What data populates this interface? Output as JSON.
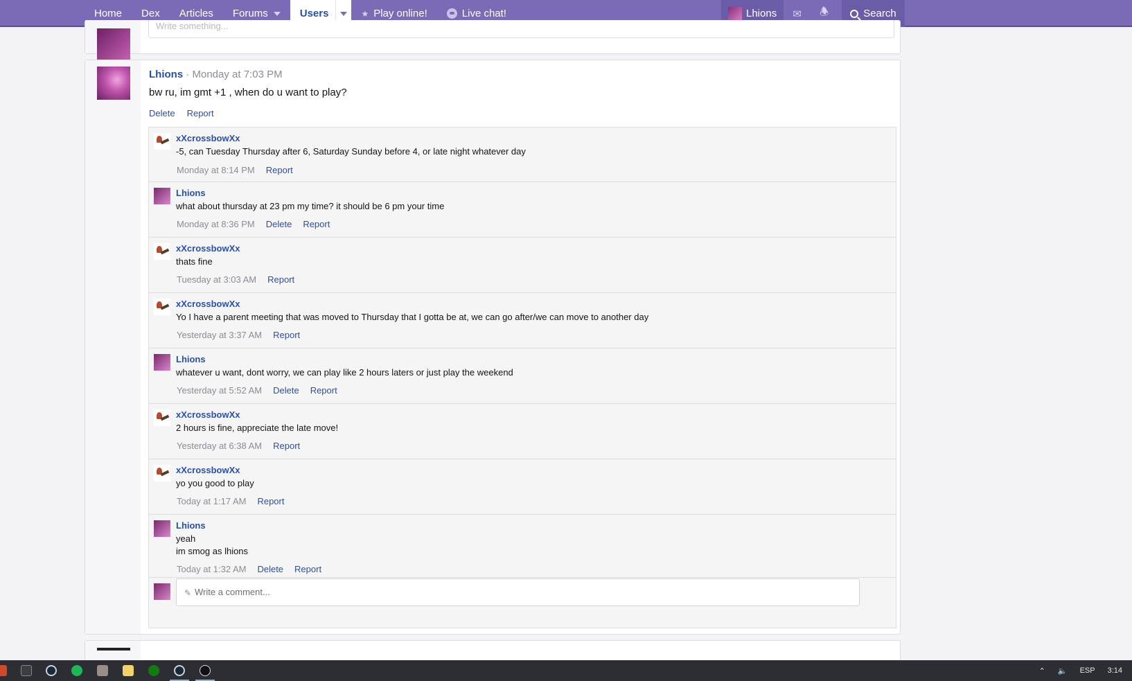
{
  "nav": {
    "items": [
      {
        "label": "Home"
      },
      {
        "label": "Dex"
      },
      {
        "label": "Articles"
      },
      {
        "label": "Forums"
      },
      {
        "label": "Users"
      },
      {
        "label": "Play online!"
      },
      {
        "label": "Live chat!"
      }
    ],
    "user": "Lhions",
    "search": "Search",
    "accent": "#7b6bb7"
  },
  "previous_comment_placeholder": "Write something...",
  "post": {
    "author": "Lhions",
    "time": "· Monday at 7:03 PM",
    "text": "bw ru, im gmt +1 , when do u want to play?",
    "actions": [
      "Delete",
      "Report"
    ]
  },
  "comments": [
    {
      "author": "xXcrossbowXx",
      "lines": [
        "-5, can Tuesday Thursday after 6, Saturday Sunday before 4, or late night whatever day"
      ],
      "time": "Monday at 8:14 PM",
      "actions": [
        "Report"
      ]
    },
    {
      "author": "Lhions",
      "lines": [
        "what about thursday at 23 pm my time? it should be 6 pm your time"
      ],
      "time": "Monday at 8:36 PM",
      "actions": [
        "Delete",
        "Report"
      ]
    },
    {
      "author": "xXcrossbowXx",
      "lines": [
        "thats fine"
      ],
      "time": "Tuesday at 3:03 AM",
      "actions": [
        "Report"
      ]
    },
    {
      "author": "xXcrossbowXx",
      "lines": [
        "Yo I have a parent meeting that was moved to Thursday that I gotta be at, we can go after/we can move to another day"
      ],
      "time": "Yesterday at 3:37 AM",
      "actions": [
        "Report"
      ]
    },
    {
      "author": "Lhions",
      "lines": [
        "whatever u want, dont worry, we can play like 2 hours laters or just play the weekend"
      ],
      "time": "Yesterday at 5:52 AM",
      "actions": [
        "Delete",
        "Report"
      ]
    },
    {
      "author": "xXcrossbowXx",
      "lines": [
        "2 hours is fine, appreciate the late move!"
      ],
      "time": "Yesterday at 6:38 AM",
      "actions": [
        "Report"
      ]
    },
    {
      "author": "xXcrossbowXx",
      "lines": [
        "yo you good to play"
      ],
      "time": "Today at 1:17 AM",
      "actions": [
        "Report"
      ]
    },
    {
      "author": "Lhions",
      "lines": [
        "yeah",
        "im smog as lhions"
      ],
      "time": "Today at 1:32 AM",
      "actions": [
        "Delete",
        "Report"
      ]
    }
  ],
  "write_comment_placeholder": "Write a comment...",
  "taskbar": {
    "language": "ESP",
    "clock": "3:14"
  }
}
